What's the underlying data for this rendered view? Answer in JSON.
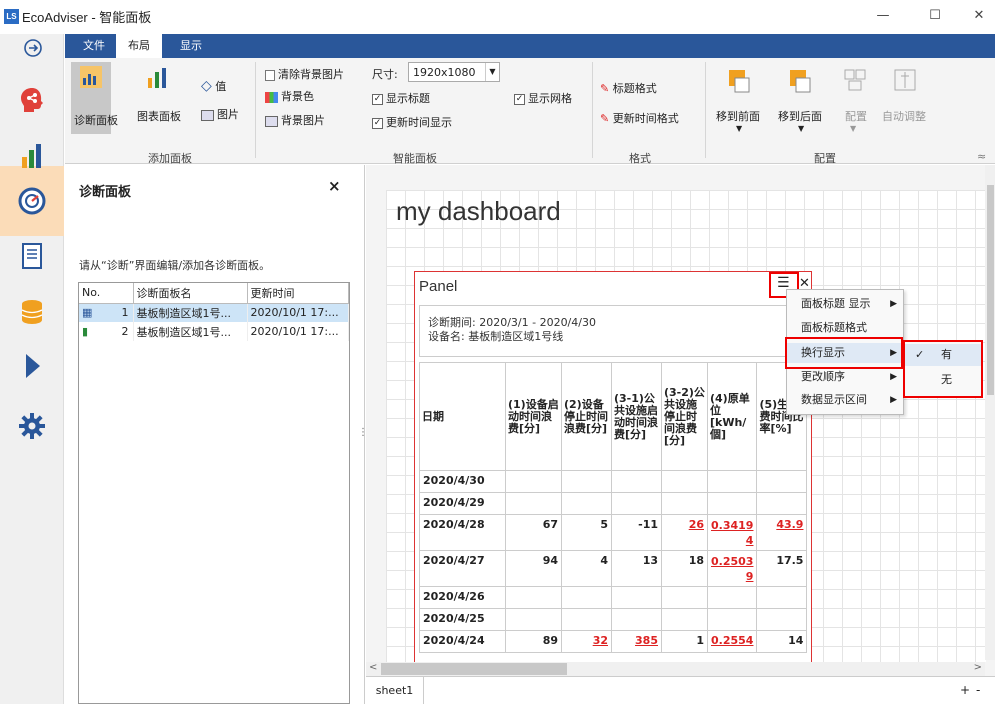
{
  "window": {
    "logo_text": "LS",
    "title": "EcoAdviser - 智能面板",
    "minimize": "—",
    "maximize": "☐",
    "close": "✕"
  },
  "ribbon_tabs": [
    {
      "label": "文件",
      "active": false
    },
    {
      "label": "布局",
      "active": true
    },
    {
      "label": "显示",
      "active": false
    }
  ],
  "ribbon": {
    "add_panel": {
      "diagnostic_panel": "诊断面板",
      "chart_panel": "图表面板",
      "value": "值",
      "image": "图片",
      "group_label": "添加面板"
    },
    "smart_panel": {
      "clear_bg_image": "清除背景图片",
      "bg_color": "背景色",
      "bg_image": "背景图片",
      "size_label": "尺寸:",
      "size_value": "1920x1080",
      "show_title": "显示标题",
      "show_update_time": "更新时间显示",
      "show_grid": "显示网格",
      "group_label": "智能面板"
    },
    "format": {
      "title_format": "标题格式",
      "update_time_format": "更新时间格式",
      "group_label": "格式"
    },
    "arrange": {
      "bring_front": "移到前面",
      "send_back": "移到后面",
      "layout": "配置",
      "auto_adjust": "自动调整",
      "group_label": "配置"
    }
  },
  "left_panel": {
    "title": "诊断面板",
    "close": "×",
    "description": "请从“诊断”界面编辑/添加各诊断面板。",
    "columns": [
      "No.",
      "诊断面板名",
      "更新时间"
    ],
    "rows": [
      {
        "no": "1",
        "name": "基板制造区域1号...",
        "time": "2020/10/1 17:..."
      },
      {
        "no": "2",
        "name": "基板制造区域1号...",
        "time": "2020/10/1 17:..."
      }
    ]
  },
  "dashboard": {
    "title": "my dashboard",
    "sheet_tab": "sheet1",
    "panel": {
      "title": "Panel",
      "period": "诊断期间: 2020/3/1 - 2020/4/30",
      "device": "设备名: 基板制造区域1号线",
      "headers": [
        "日期",
        "(1)设备启动时间浪费[分]",
        "(2)设备停止时间浪费[分]",
        "(3-1)公共设施启动时间浪费[分]",
        "(3-2)公共设施停止时间浪费[分]",
        "(4)原单位[kWh/個]",
        "(5)生浪费时间比率[%]"
      ],
      "rows": [
        {
          "date": "2020/4/30",
          "v": [
            "",
            "",
            "",
            "",
            "",
            ""
          ],
          "red": []
        },
        {
          "date": "2020/4/29",
          "v": [
            "",
            "",
            "",
            "",
            "",
            ""
          ],
          "red": []
        },
        {
          "date": "2020/4/28",
          "v": [
            "67",
            "5",
            "-11",
            "26",
            "0.34194",
            "43.9"
          ],
          "red": [
            3,
            4,
            5
          ]
        },
        {
          "date": "2020/4/27",
          "v": [
            "94",
            "4",
            "13",
            "18",
            "0.25039",
            "17.5"
          ],
          "red": [
            4
          ]
        },
        {
          "date": "2020/4/26",
          "v": [
            "",
            "",
            "",
            "",
            "",
            ""
          ],
          "red": []
        },
        {
          "date": "2020/4/25",
          "v": [
            "",
            "",
            "",
            "",
            "",
            ""
          ],
          "red": []
        },
        {
          "date": "2020/4/24",
          "v": [
            "89",
            "32",
            "385",
            "1",
            "0.2554",
            "14"
          ],
          "red": [
            1,
            2,
            4
          ]
        }
      ]
    }
  },
  "context_menu": {
    "items": [
      {
        "label": "面板标题 显示",
        "arrow": true
      },
      {
        "label": "面板标题格式",
        "arrow": false
      },
      {
        "label": "换行显示",
        "arrow": true
      },
      {
        "label": "更改顺序",
        "arrow": true
      },
      {
        "label": "数据显示区间",
        "arrow": true
      }
    ],
    "submenu": [
      {
        "label": "有",
        "checked": true
      },
      {
        "label": "无",
        "checked": false
      }
    ]
  },
  "colors": {
    "ribbon_tab_bar": "#2a579a",
    "highlight_red": "#e00000",
    "rail_selected": "#fbdcb8"
  }
}
